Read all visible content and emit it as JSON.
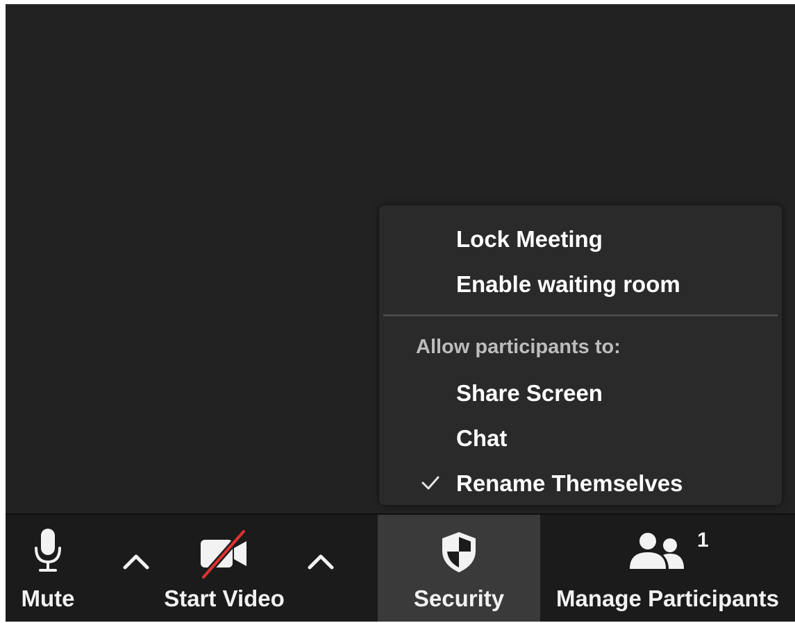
{
  "security_menu": {
    "items_top": [
      {
        "label": "Lock Meeting"
      },
      {
        "label": "Enable waiting room"
      }
    ],
    "section_label": "Allow participants to:",
    "items_allow": [
      {
        "label": "Share Screen",
        "checked": false
      },
      {
        "label": "Chat",
        "checked": false
      },
      {
        "label": "Rename Themselves",
        "checked": true
      }
    ]
  },
  "toolbar": {
    "mute_label": "Mute",
    "video_label": "Start Video",
    "security_label": "Security",
    "participants_label": "Manage Participants",
    "participants_count": "1",
    "icons": {
      "mute": "microphone-icon",
      "video": "video-off-icon",
      "security": "shield-icon",
      "participants": "participants-icon",
      "caret": "chevron-up-icon"
    }
  },
  "colors": {
    "video_bg": "#222222",
    "toolbar_bg": "#1b1b1b",
    "menu_bg": "#2a2a2a",
    "security_active_bg": "#3a3a3a",
    "video_off_slash": "#e03131"
  }
}
